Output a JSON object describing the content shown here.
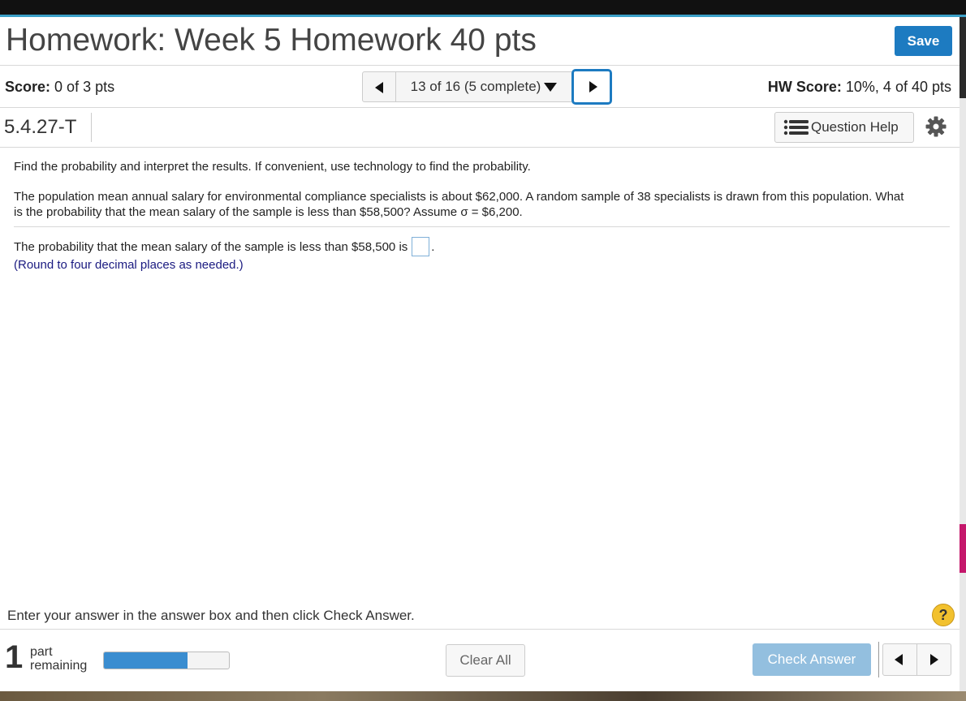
{
  "header": {
    "title": "Homework: Week 5 Homework 40 pts",
    "save_label": "Save"
  },
  "scorebar": {
    "score_label": "Score:",
    "score_value": "0 of 3 pts",
    "question_position": "13 of 16 (5 complete)",
    "hw_score_label": "HW Score:",
    "hw_score_value": "10%, 4 of 40 pts"
  },
  "question": {
    "id": "5.4.27-T",
    "help_label": "Question Help",
    "instruction": "Find the probability and interpret the results. If convenient, use technology to find the probability.",
    "body": "The population mean annual salary for environmental compliance specialists is about $62,000. A random sample of 38 specialists is drawn from this population. What is the probability that the mean salary of the sample is less than $58,500? Assume σ = $6,200.",
    "answer_prompt": "The probability that the mean salary of the sample is less than $58,500 is",
    "answer_suffix": ".",
    "answer_value": "",
    "rounding_note": "(Round to four decimal places as needed.)"
  },
  "footer": {
    "instructions": "Enter your answer in the answer box and then click Check Answer.",
    "help_mark": "?",
    "parts_remaining_count": "1",
    "parts_remaining_label_1": "part",
    "parts_remaining_label_2": "remaining",
    "progress_fraction": 0.67,
    "clear_all_label": "Clear All",
    "check_answer_label": "Check Answer"
  },
  "colors": {
    "accent": "#1d7bc1",
    "check_button_disabled": "#93bfdf",
    "progress_fill": "#3a8dd0",
    "help_mark": "#f2c12e",
    "rounding_note": "#1a1a80"
  },
  "icons": {
    "prev": "triangle-left-icon",
    "next": "triangle-right-icon",
    "dropdown": "caret-down-icon",
    "help_list": "list-icon",
    "settings": "gear-icon"
  }
}
